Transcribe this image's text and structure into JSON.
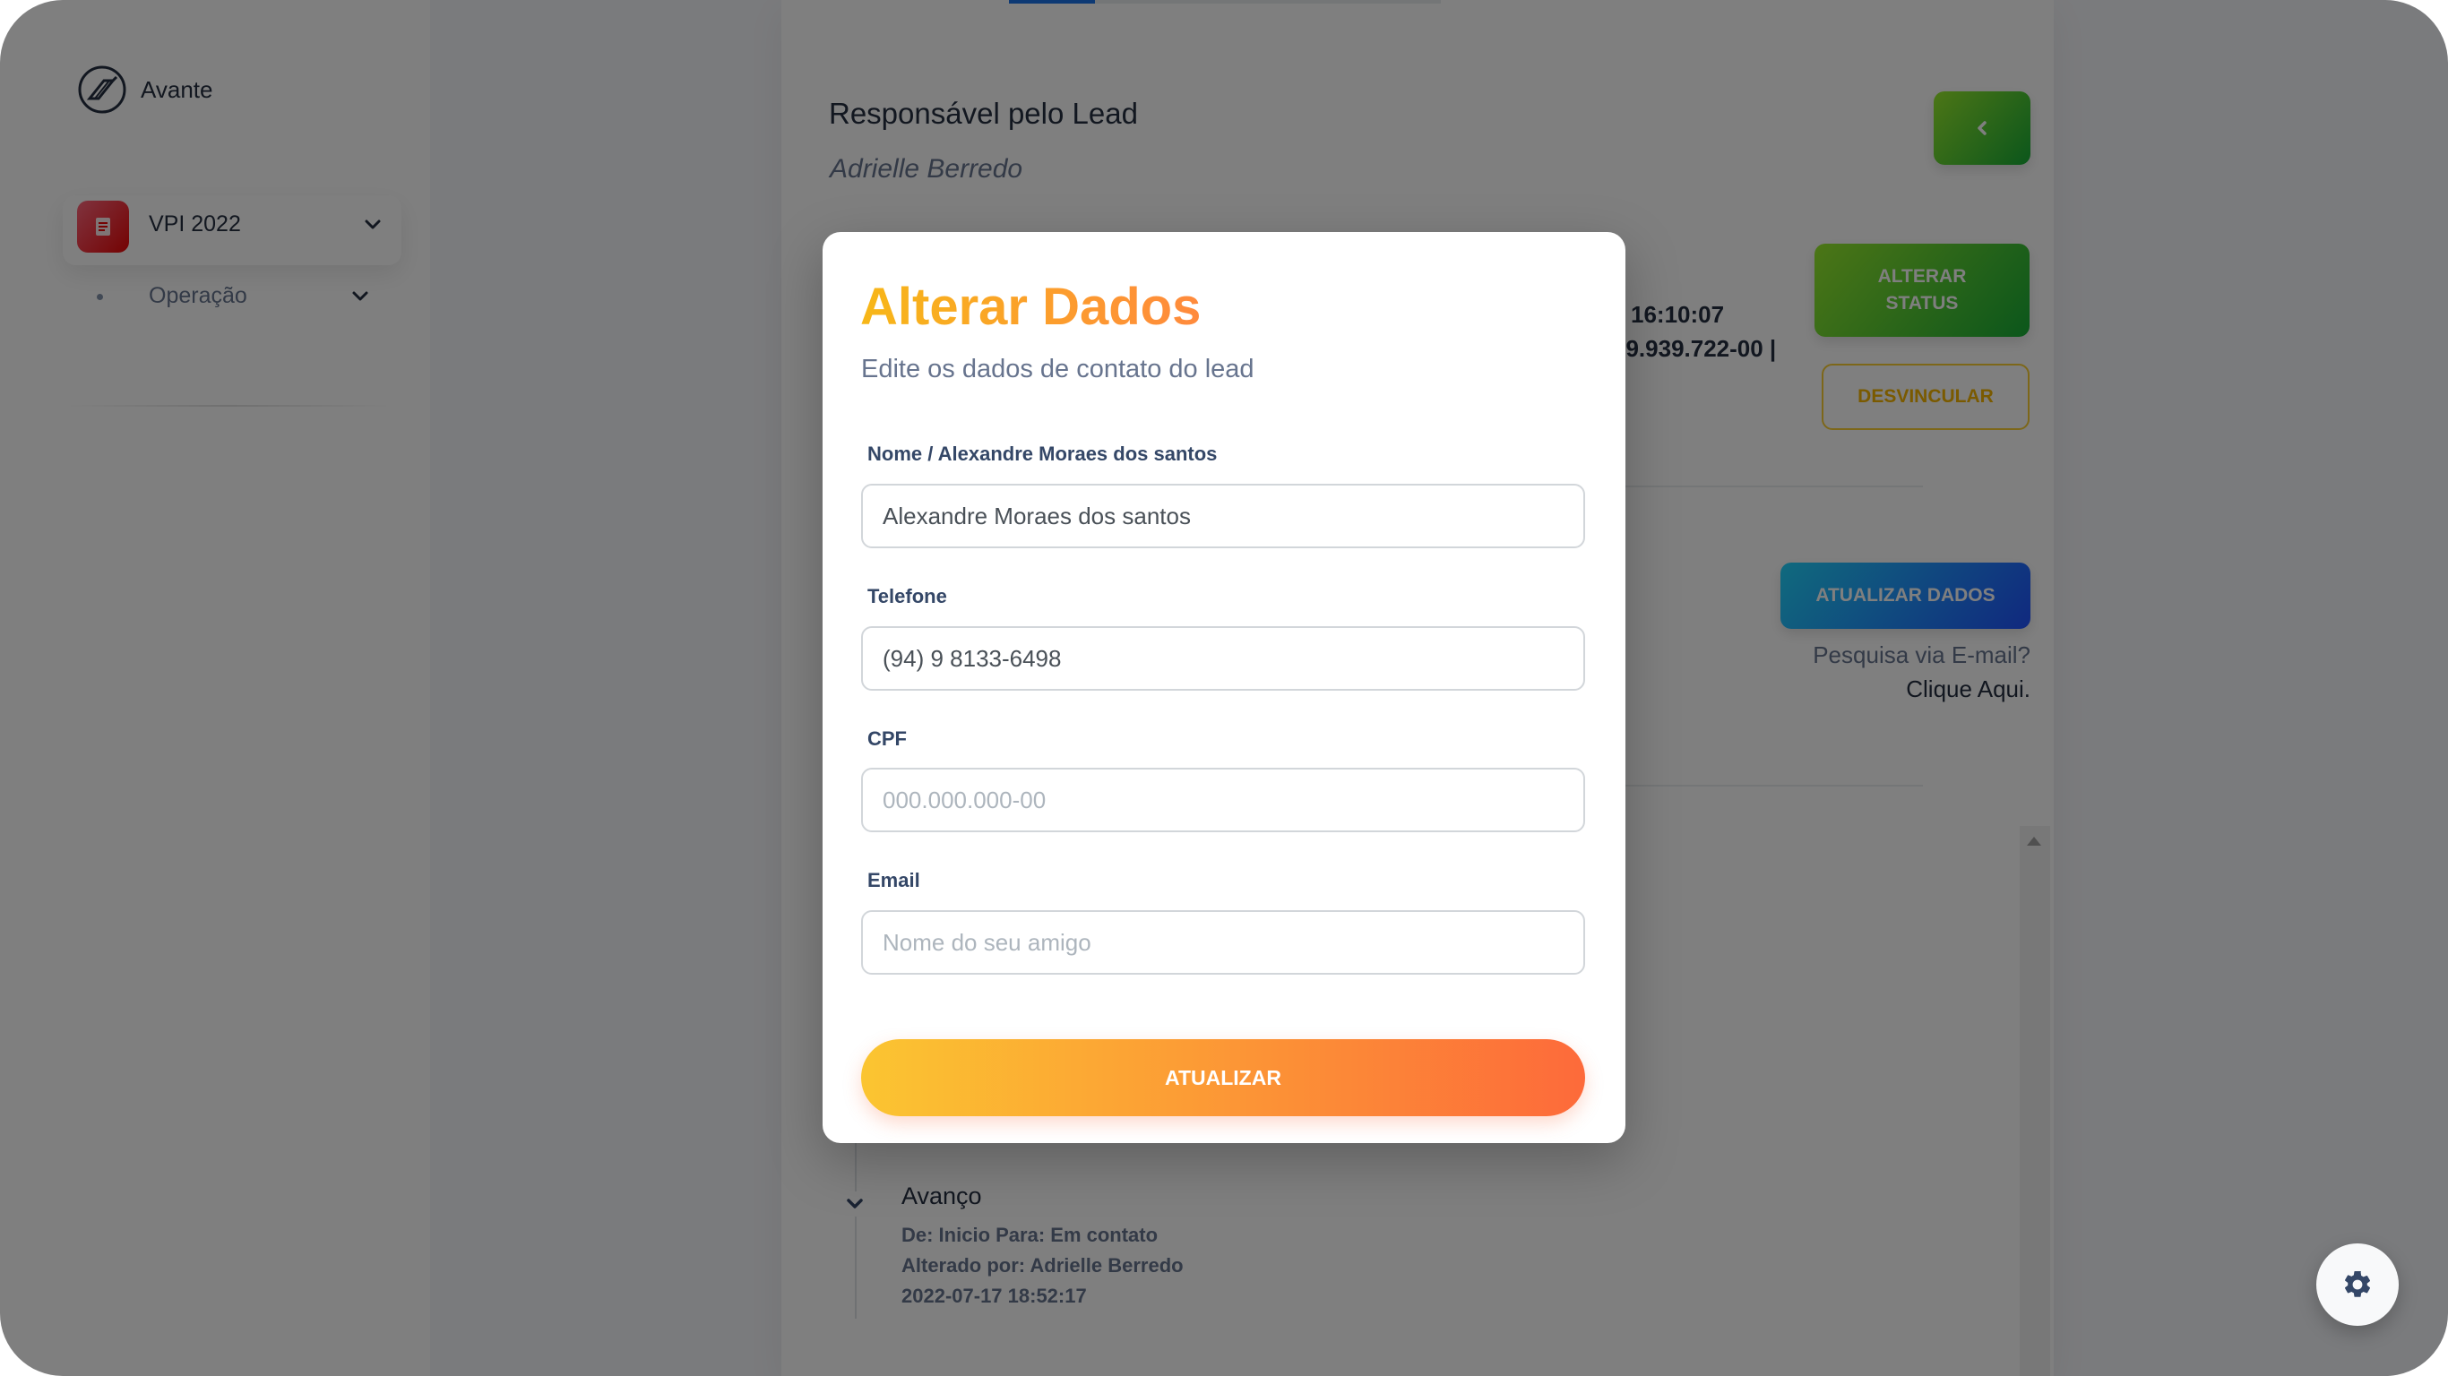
{
  "brand": {
    "name": "Avante"
  },
  "sidebar": {
    "menu": {
      "label": "VPI 2022",
      "icon": "document-icon",
      "accent": "#ea0606"
    },
    "subitem": {
      "label": "Operação"
    }
  },
  "lead": {
    "responsible_title": "Responsável pelo Lead",
    "responsible_name": "Adrielle Berredo",
    "time_fragment": "16:10:07",
    "cpf_fragment": "29.939.722-00 |"
  },
  "actions": {
    "alterar_status": "ALTERAR STATUS",
    "desvincular": "DESVINCULAR",
    "atualizar_dados": "ATUALIZAR DADOS",
    "email_question": "Pesquisa via E-mail?",
    "email_link": "Clique Aqui."
  },
  "timeline": {
    "title": "Avanço",
    "line1": "De: Inicio Para: Em contato",
    "line2": "Alterado por: Adrielle Berredo",
    "line3": "2022-07-17 18:52:17"
  },
  "modal": {
    "title": "Alterar Dados",
    "subtitle": "Edite os dados de contato do lead",
    "fields": {
      "name": {
        "label": "Nome / Alexandre Moraes dos santos",
        "value": "Alexandre Moraes dos santos",
        "placeholder": ""
      },
      "phone": {
        "label": "Telefone",
        "value": "(94) 9 8133-6498",
        "placeholder": ""
      },
      "cpf": {
        "label": "CPF",
        "value": "",
        "placeholder": "000.000.000-00"
      },
      "email": {
        "label": "Email",
        "value": "",
        "placeholder": "Nome do seu amigo"
      }
    },
    "submit": "ATUALIZAR"
  },
  "colors": {
    "primary_green": "#17ad37",
    "info_blue": "#2152ff",
    "warning": "#fbcf33",
    "gradient_orange_start": "#fbc531",
    "gradient_orange_end": "#fd6a3a"
  }
}
